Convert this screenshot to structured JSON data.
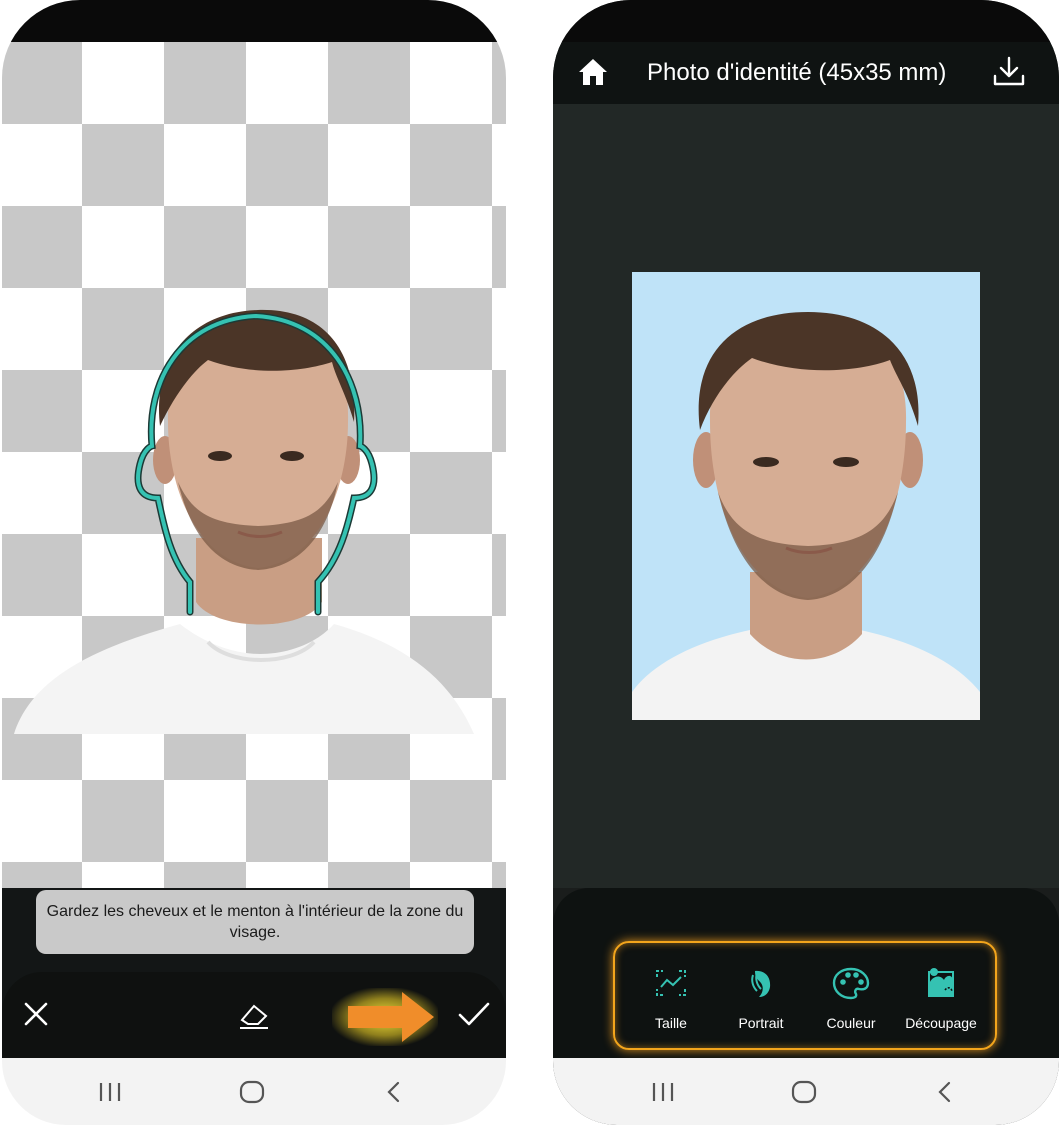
{
  "editor": {
    "hint": "Gardez les cheveux et le menton à l'intérieur de la zone du visage.",
    "close_icon": "close-icon",
    "eraser_icon": "eraser-icon",
    "arrow_icon": "arrow-right-icon",
    "confirm_icon": "check-icon"
  },
  "preview": {
    "title": "Photo d'identité (45x35 mm)",
    "home_icon": "home-icon",
    "download_icon": "download-icon",
    "photo_background": "#bfe3f8",
    "tools": [
      {
        "label": "Taille",
        "icon": "resize-icon"
      },
      {
        "label": "Portrait",
        "icon": "portrait-icon"
      },
      {
        "label": "Couleur",
        "icon": "palette-icon"
      },
      {
        "label": "Découpage",
        "icon": "cutout-icon"
      }
    ]
  },
  "colors": {
    "accent": "#35c2b2",
    "highlight_orange": "#f08d2a",
    "highlight_frame": "#f3a51c"
  },
  "nav": {
    "recents_icon": "recents-icon",
    "home_icon": "home-circle-icon",
    "back_icon": "back-icon"
  }
}
